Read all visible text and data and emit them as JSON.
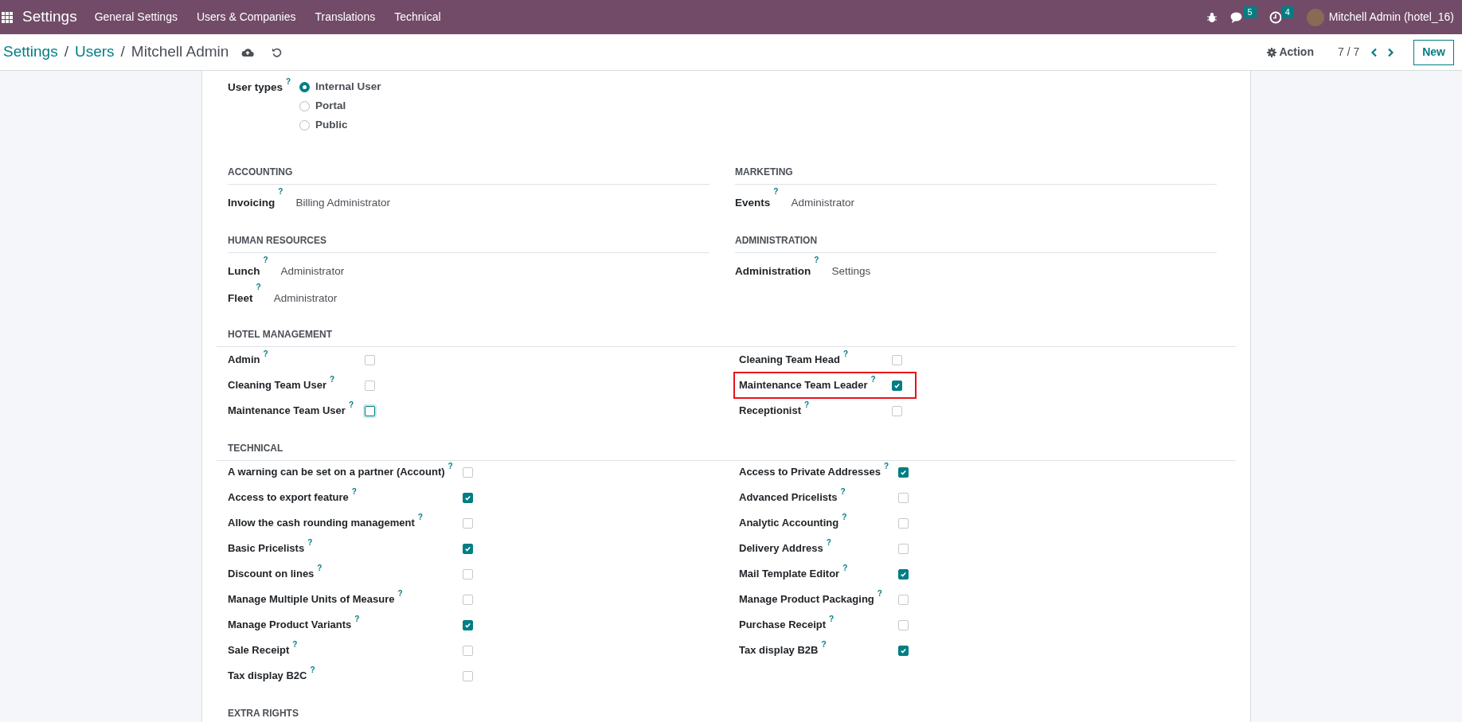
{
  "topbar": {
    "app": "Settings",
    "menu": [
      "General Settings",
      "Users & Companies",
      "Translations",
      "Technical"
    ],
    "chat_count": "5",
    "activity_count": "4",
    "user": "Mitchell Admin (hotel_16)"
  },
  "control_bar": {
    "breadcrumbs": [
      {
        "label": "Settings",
        "kind": "link"
      },
      {
        "label": "Users",
        "kind": "link"
      },
      {
        "label": "Mitchell Admin",
        "kind": "current"
      }
    ],
    "separators": [
      "/",
      "/"
    ],
    "action": "Action",
    "pager": "7 / 7",
    "new_button": "New"
  },
  "user_types": {
    "label": "User types",
    "help": "?",
    "options": [
      {
        "label": "Internal User",
        "selected": true
      },
      {
        "label": "Portal",
        "selected": false
      },
      {
        "label": "Public",
        "selected": false
      }
    ]
  },
  "group_rows": [
    [
      {
        "title": "ACCOUNTING",
        "fields": [
          {
            "label": "Invoicing",
            "help": "?",
            "value": "Billing Administrator"
          }
        ]
      },
      {
        "title": "MARKETING",
        "fields": [
          {
            "label": "Events",
            "help": "?",
            "value": "Administrator"
          }
        ]
      }
    ],
    [
      {
        "title": "HUMAN RESOURCES",
        "fields": [
          {
            "label": "Lunch",
            "help": "?",
            "value": "Administrator"
          },
          {
            "label": "Fleet",
            "help": "?",
            "value": "Administrator"
          }
        ]
      },
      {
        "title": "ADMINISTRATION",
        "fields": [
          {
            "label": "Administration",
            "help": "?",
            "value": "Settings"
          }
        ]
      }
    ]
  ],
  "hotel_management": {
    "title": "HOTEL MANAGEMENT",
    "left": [
      {
        "label": "Admin",
        "help": "?",
        "checked": false,
        "focused": false,
        "highlighted": false
      },
      {
        "label": "Cleaning Team User",
        "help": "?",
        "checked": false,
        "focused": false,
        "highlighted": false
      },
      {
        "label": "Maintenance Team User",
        "help": "?",
        "checked": false,
        "focused": true,
        "highlighted": false
      }
    ],
    "right": [
      {
        "label": "Cleaning Team Head",
        "help": "?",
        "checked": false,
        "focused": false,
        "highlighted": false
      },
      {
        "label": "Maintenance Team Leader",
        "help": "?",
        "checked": true,
        "focused": false,
        "highlighted": true
      },
      {
        "label": "Receptionist",
        "help": "?",
        "checked": false,
        "focused": false,
        "highlighted": false
      }
    ]
  },
  "technical": {
    "title": "TECHNICAL",
    "left": [
      {
        "label": "A warning can be set on a partner (Account)",
        "help": "?",
        "checked": false
      },
      {
        "label": "Access to export feature",
        "help": "?",
        "checked": true
      },
      {
        "label": "Allow the cash rounding management",
        "help": "?",
        "checked": false
      },
      {
        "label": "Basic Pricelists",
        "help": "?",
        "checked": true
      },
      {
        "label": "Discount on lines",
        "help": "?",
        "checked": false
      },
      {
        "label": "Manage Multiple Units of Measure",
        "help": "?",
        "checked": false
      },
      {
        "label": "Manage Product Variants",
        "help": "?",
        "checked": true
      },
      {
        "label": "Sale Receipt",
        "help": "?",
        "checked": false
      },
      {
        "label": "Tax display B2C",
        "help": "?",
        "checked": false
      }
    ],
    "right": [
      {
        "label": "Access to Private Addresses",
        "help": "?",
        "checked": true
      },
      {
        "label": "Advanced Pricelists",
        "help": "?",
        "checked": false
      },
      {
        "label": "Analytic Accounting",
        "help": "?",
        "checked": false
      },
      {
        "label": "Delivery Address",
        "help": "?",
        "checked": false
      },
      {
        "label": "Mail Template Editor",
        "help": "?",
        "checked": true
      },
      {
        "label": "Manage Product Packaging",
        "help": "?",
        "checked": false
      },
      {
        "label": "Purchase Receipt",
        "help": "?",
        "checked": false
      },
      {
        "label": "Tax display B2B",
        "help": "?",
        "checked": true
      }
    ]
  },
  "extra_rights": {
    "title": "EXTRA RIGHTS"
  }
}
